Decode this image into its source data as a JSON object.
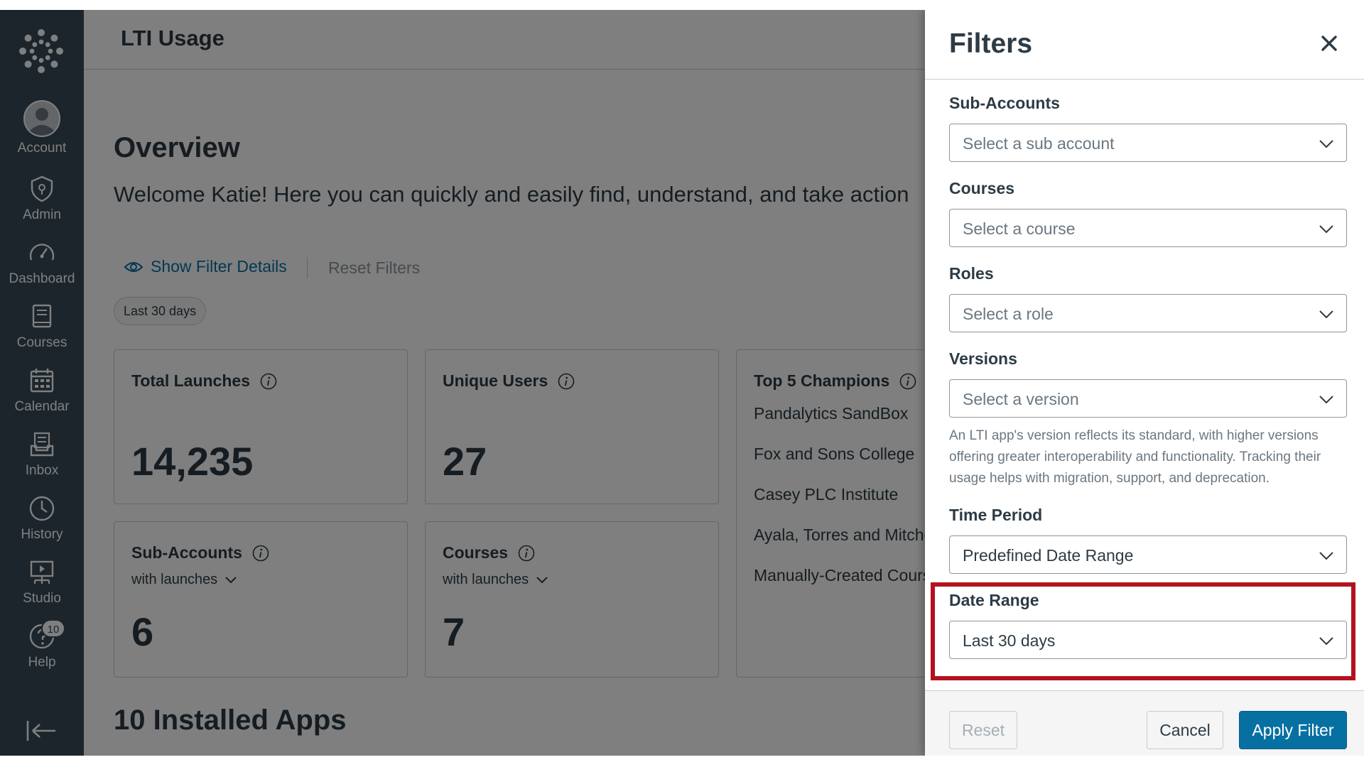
{
  "nav": {
    "items": [
      {
        "label": "Account",
        "icon": "user-avatar-icon"
      },
      {
        "label": "Admin",
        "icon": "shield-icon"
      },
      {
        "label": "Dashboard",
        "icon": "speedometer-icon"
      },
      {
        "label": "Courses",
        "icon": "book-icon"
      },
      {
        "label": "Calendar",
        "icon": "calendar-icon"
      },
      {
        "label": "Inbox",
        "icon": "inbox-icon"
      },
      {
        "label": "History",
        "icon": "clock-icon"
      },
      {
        "label": "Studio",
        "icon": "studio-icon"
      },
      {
        "label": "Help",
        "icon": "help-icon",
        "badge": "10"
      }
    ]
  },
  "page": {
    "title": "LTI Usage",
    "heading": "Overview",
    "welcome": "Welcome Katie! Here you can quickly and easily find, understand, and take action",
    "show_filter_details": "Show Filter Details",
    "reset_filters": "Reset Filters",
    "active_filter_pill": "Last 30 days",
    "installed_apps": "10 Installed Apps"
  },
  "cards": {
    "total_launches": {
      "title": "Total Launches",
      "value": "14,235"
    },
    "unique_users": {
      "title": "Unique Users",
      "value": "27"
    },
    "sub_accounts": {
      "title": "Sub-Accounts",
      "subtitle": "with launches",
      "value": "6"
    },
    "courses": {
      "title": "Courses",
      "subtitle": "with launches",
      "value": "7"
    },
    "champions": {
      "title": "Top 5 Champions",
      "items": [
        "Pandalytics SandBox",
        "Fox and Sons College",
        "Casey PLC Institute",
        "Ayala, Torres and Mitche",
        "Manually-Created Cours"
      ]
    }
  },
  "filters": {
    "title": "Filters",
    "sub_accounts": {
      "label": "Sub-Accounts",
      "placeholder": "Select a sub account"
    },
    "courses": {
      "label": "Courses",
      "placeholder": "Select a course"
    },
    "roles": {
      "label": "Roles",
      "placeholder": "Select a role"
    },
    "versions": {
      "label": "Versions",
      "placeholder": "Select a version"
    },
    "versions_help": "An LTI app's version reflects its standard, with higher versions offering greater interoperability and functionality. Tracking their usage helps with migration, support, and deprecation.",
    "time_period": {
      "label": "Time Period",
      "value": "Predefined Date Range"
    },
    "date_range": {
      "label": "Date Range",
      "value": "Last 30 days"
    },
    "buttons": {
      "reset": "Reset",
      "cancel": "Cancel",
      "apply": "Apply Filter"
    }
  },
  "colors": {
    "nav_bg": "#394b58",
    "link": "#0770a3",
    "primary_button": "#0770a3",
    "highlight": "#b3121f",
    "text": "#2d3b45"
  }
}
